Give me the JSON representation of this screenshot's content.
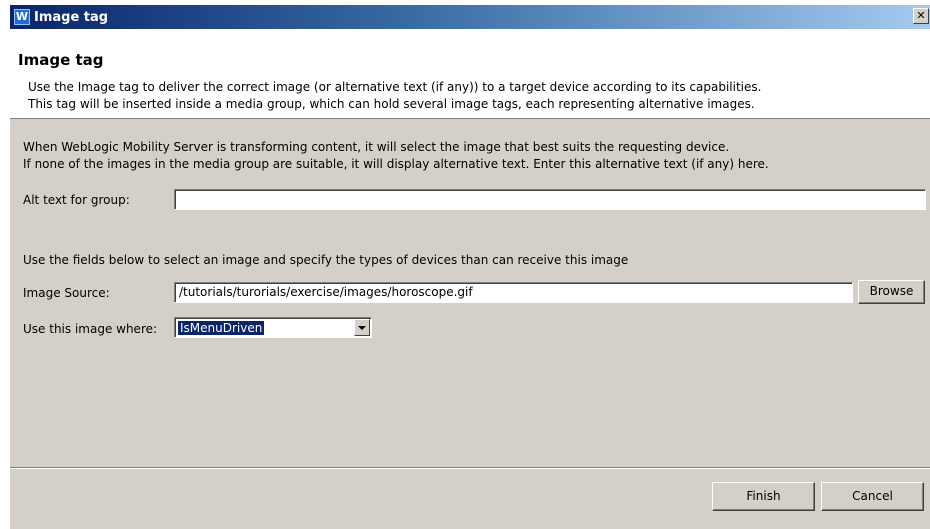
{
  "window": {
    "title": "Image tag",
    "close_glyph": "✕"
  },
  "banner": {
    "heading": "Image tag",
    "line1": "Use the Image tag to deliver the correct image (or alternative text (if any)) to a target device according to its capabilities.",
    "line2": "This tag will be inserted inside a media group, which can hold several image tags, each representing alternative images."
  },
  "form": {
    "intro_line1": "When WebLogic Mobility Server is transforming content, it will select the image that best suits the requesting device.",
    "intro_line2": "If none of the images in the media group are suitable, it will display alternative text. Enter this alternative text (if any) here.",
    "alt_text_label": "Alt text for group:",
    "alt_text_value": "",
    "fields_intro": "Use the fields below to select an image and specify the types of devices than can receive this image",
    "image_source_label": "Image Source:",
    "image_source_value": "/tutorials/turorials/exercise/images/horoscope.gif",
    "browse_label": "Browse",
    "use_where_label": "Use this image where:",
    "use_where_value": "IsMenuDriven"
  },
  "footer": {
    "finish_label": "Finish",
    "cancel_label": "Cancel"
  },
  "icons": {
    "app": "weblogic-w-icon",
    "close": "close-icon",
    "dropdown": "chevron-down-icon"
  },
  "colors": {
    "titlebar_start": "#0a246a",
    "titlebar_end": "#a6caf0",
    "dialog_bg": "#d4d0c8",
    "selection": "#0a246a"
  }
}
